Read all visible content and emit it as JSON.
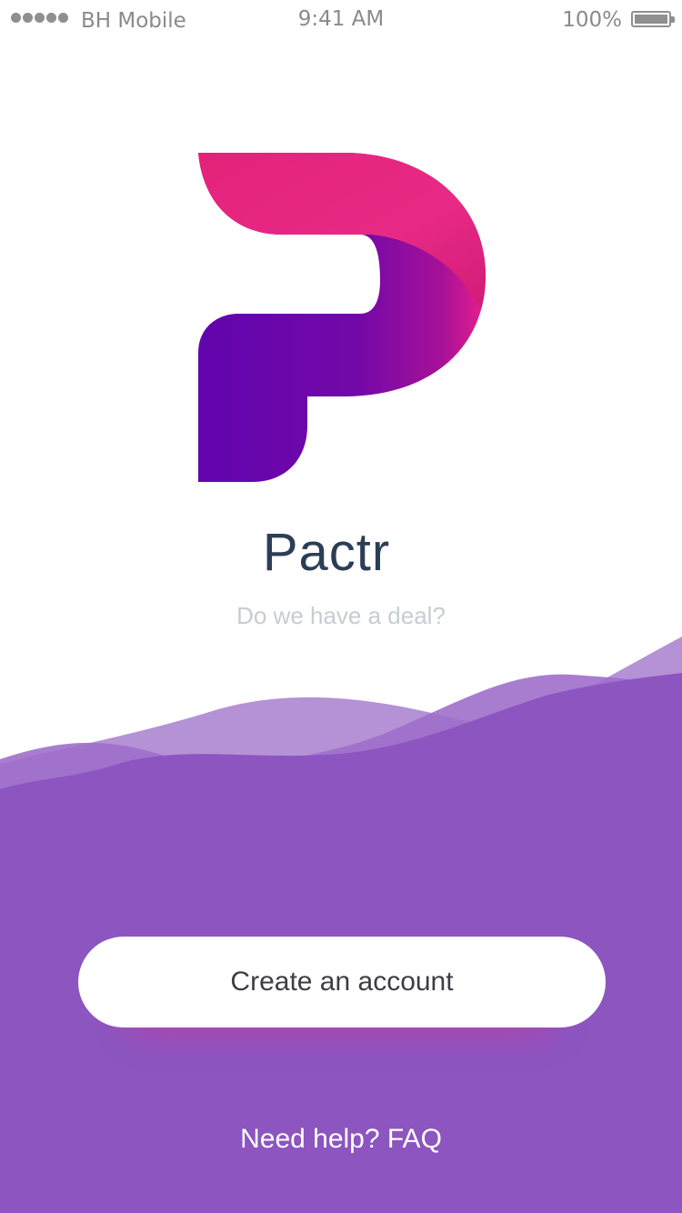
{
  "status_bar": {
    "carrier": "BH Mobile",
    "time": "9:41 AM",
    "battery_percent": "100%",
    "signal_bars": 5,
    "icons": [
      "signal-dots-icon",
      "battery-icon"
    ]
  },
  "app": {
    "name": "Pactr",
    "tagline": "Do we have a deal?",
    "logo_icon": "pactr-p-logo-icon"
  },
  "actions": {
    "create_account_label": "Create an account",
    "help_label": "Need help? FAQ"
  },
  "colors": {
    "brand_pink": "#E8288C",
    "brand_purple": "#6508AE",
    "background_purple": "#8C55C0",
    "title_text": "#2C3E55",
    "tagline_text": "#C7CCD3",
    "button_text": "#3D3D45"
  }
}
